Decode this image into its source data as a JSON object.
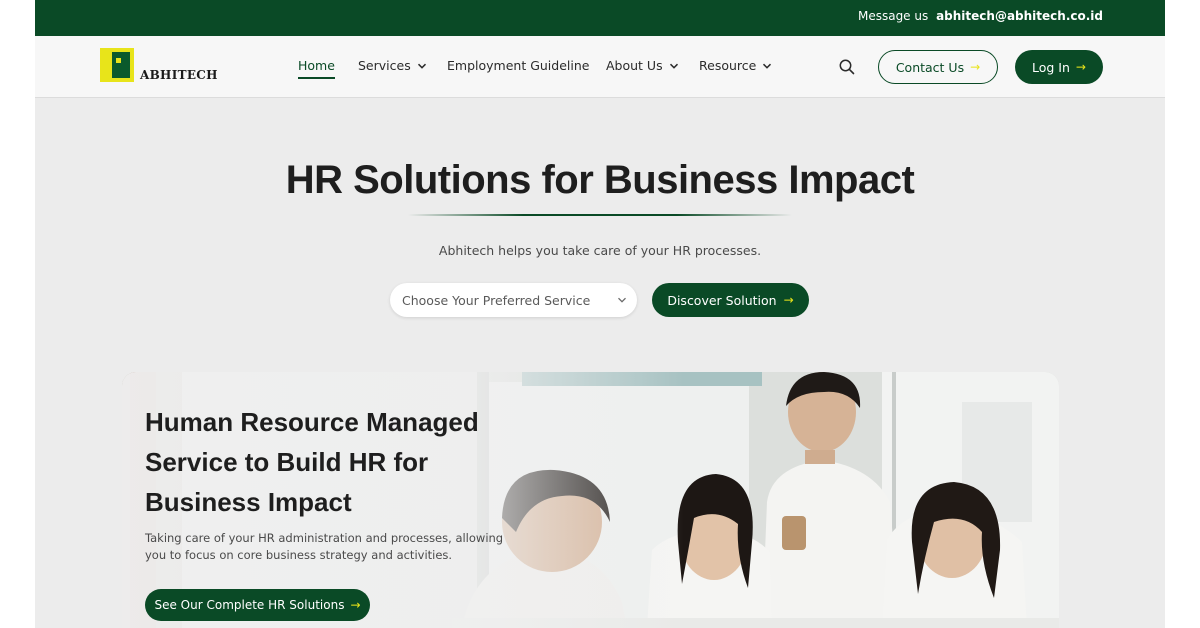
{
  "topbar": {
    "message_label": "Message us",
    "email": "abhitech@abhitech.co.id"
  },
  "brand": {
    "name": "ABHITECH",
    "logo_icon": "abhitech-logo-icon",
    "logo_colors": [
      "#e8e41a",
      "#0b5a2c"
    ]
  },
  "nav": {
    "items": [
      {
        "label": "Home",
        "active": true,
        "has_dropdown": false
      },
      {
        "label": "Services",
        "active": false,
        "has_dropdown": true
      },
      {
        "label": "Employment Guideline",
        "active": false,
        "has_dropdown": false
      },
      {
        "label": "About Us",
        "active": false,
        "has_dropdown": true
      },
      {
        "label": "Resource",
        "active": false,
        "has_dropdown": true
      }
    ],
    "search_icon": "search-icon",
    "contact_label": "Contact Us",
    "login_label": "Log In"
  },
  "hero": {
    "title": "HR Solutions for Business Impact",
    "subtitle": "Abhitech helps you take care of your HR processes.",
    "select_placeholder": "Choose Your Preferred Service",
    "discover_label": "Discover Solution"
  },
  "feature": {
    "title": "Human Resource Managed Service to Build HR for Business Impact",
    "description": "Taking care of your HR administration and processes, allowing you to focus on core business strategy and activities.",
    "cta_label": "See Our Complete HR Solutions"
  },
  "colors": {
    "brand_green": "#0a4a26",
    "accent_yellow": "#e8e41a",
    "page_bg": "#ececec"
  }
}
